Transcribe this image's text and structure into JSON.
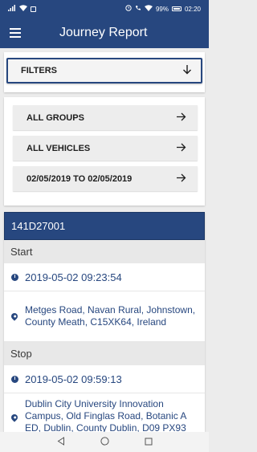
{
  "status_bar": {
    "battery_percent": "99%",
    "time": "02:20"
  },
  "app_bar": {
    "title": "Journey Report"
  },
  "filters": {
    "label": "FILTERS"
  },
  "options": [
    {
      "label": "ALL GROUPS"
    },
    {
      "label": "ALL VEHICLES"
    },
    {
      "label": "02/05/2019 TO 02/05/2019"
    }
  ],
  "journey": {
    "vehicle": "141D27001",
    "start": {
      "heading": "Start",
      "time": "2019-05-02 09:23:54",
      "address": "Metges Road, Navan Rural, Johnstown, County Meath, C15XK64, Ireland"
    },
    "stop": {
      "heading": "Stop",
      "time": "2019-05-02 09:59:13",
      "address": "Dublin City University Innovation Campus, Old Finglas Road, Botanic A ED, Dublin, County Dublin, D09 PX93"
    }
  },
  "colors": {
    "primary": "#27477f",
    "section_bg": "#e8e8e8",
    "button_bg": "#ededed"
  }
}
